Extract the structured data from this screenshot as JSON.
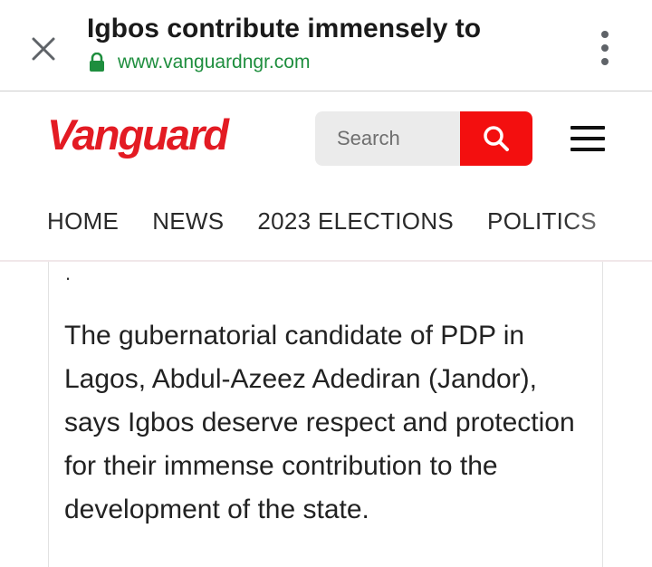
{
  "browser": {
    "title": "Igbos contribute immensely to",
    "url": "www.vanguardngr.com",
    "icons": {
      "close": "close-icon",
      "lock": "lock-icon",
      "menu": "more-vert-icon"
    },
    "url_color": "#1e8e3e"
  },
  "site": {
    "logo": "Vanguard",
    "brand_color": "#e31b23",
    "search": {
      "placeholder": "Search",
      "value": "",
      "icon": "search-icon"
    },
    "menu_icon": "hamburger-menu-icon",
    "nav": [
      {
        "label": "HOME"
      },
      {
        "label": "NEWS"
      },
      {
        "label": "2023 ELECTIONS"
      },
      {
        "label": "POLITICS"
      }
    ]
  },
  "article": {
    "stray": ".",
    "paragraph": "The gubernatorial candidate of PDP in Lagos, Abdul-Azeez Adediran (Jandor), says Igbos deserve respect and protection for their immense contribution to the development of the state."
  }
}
